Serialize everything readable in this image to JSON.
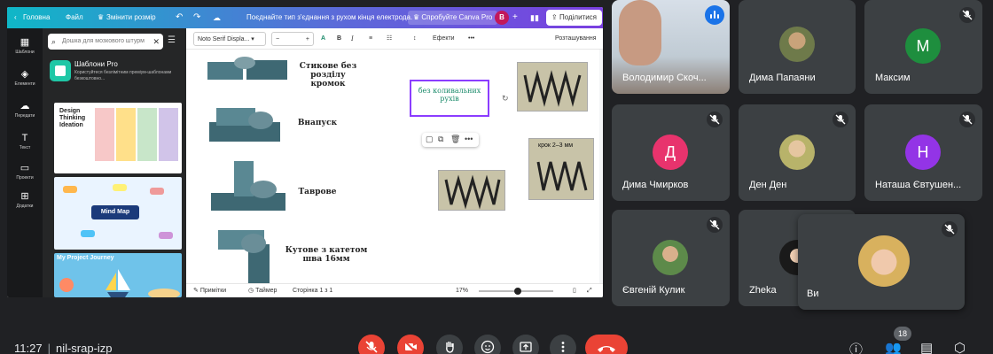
{
  "shared_screen": {
    "topbar": {
      "home_label": "Головна",
      "file_label": "Файл",
      "resize_label": "Змінити розмір",
      "hint_text": "Поєднайте тип з'єднання з рухом кінця електрода.",
      "try_pro_label": "Спробуйте Canva Pro",
      "avatar_letter": "B",
      "share_label": "Поділитися"
    },
    "rail": [
      {
        "label": "Шаблони",
        "icon": "templates-icon"
      },
      {
        "label": "Елементи",
        "icon": "elements-icon"
      },
      {
        "label": "Передати",
        "icon": "upload-icon"
      },
      {
        "label": "Текст",
        "icon": "text-icon"
      },
      {
        "label": "Проекти",
        "icon": "folder-icon"
      },
      {
        "label": "Додатки",
        "icon": "apps-icon"
      }
    ],
    "panel": {
      "search_placeholder": "Дошка для мозкового штурм",
      "pro_title": "Шаблони Pro",
      "pro_desc": "Користуйтеся безлімітним преміум-шаблонами безкоштовно...",
      "thumb1_title": "Design Thinking Ideation",
      "thumb2_title": "Mind Map",
      "thumb3_title": "My Project Journey"
    },
    "toolbar": {
      "font": "Noto Serif Displa...",
      "size_minus": "−",
      "size_plus": "+",
      "effects": "Ефекти",
      "more": "•••",
      "position": "Розташування"
    },
    "slide": {
      "label1": "Стикове без розділу кромок",
      "label2": "Внапуск",
      "label3": "Таврове",
      "label4": "Кутове з катетом шва 16мм",
      "selected_text": "без коливальних рухів",
      "photo_caption": "крок 2–3 мм"
    },
    "bottombar": {
      "notes": "Примітки",
      "timer": "Таймер",
      "page": "Сторінка 1 з 1",
      "zoom": "17%"
    }
  },
  "participants": [
    {
      "name": "Володимир Скоч...",
      "speaking": true
    },
    {
      "name": "Дима Папаяни",
      "muted": false
    },
    {
      "name": "Максим",
      "letter": "M",
      "color": "#1e8e3e",
      "muted": true
    },
    {
      "name": "Дима Чмирков",
      "letter": "Д",
      "color": "#e8336d",
      "muted": true
    },
    {
      "name": "Ден Ден",
      "muted": true
    },
    {
      "name": "Наташа Євтушен...",
      "letter": "Н",
      "color": "#9334e6",
      "muted": true
    },
    {
      "name": "Євгеній Кулик",
      "muted": true
    },
    {
      "name": "Zheka",
      "muted": false
    },
    {
      "name": "Ви",
      "muted": true
    }
  ],
  "meeting": {
    "time": "11:27",
    "code": "nil-srap-izp",
    "participant_count": "18"
  },
  "colors": {
    "end_call": "#ea4335",
    "tile_bg": "#3c4043",
    "canva_accent": "#8b3dff"
  }
}
